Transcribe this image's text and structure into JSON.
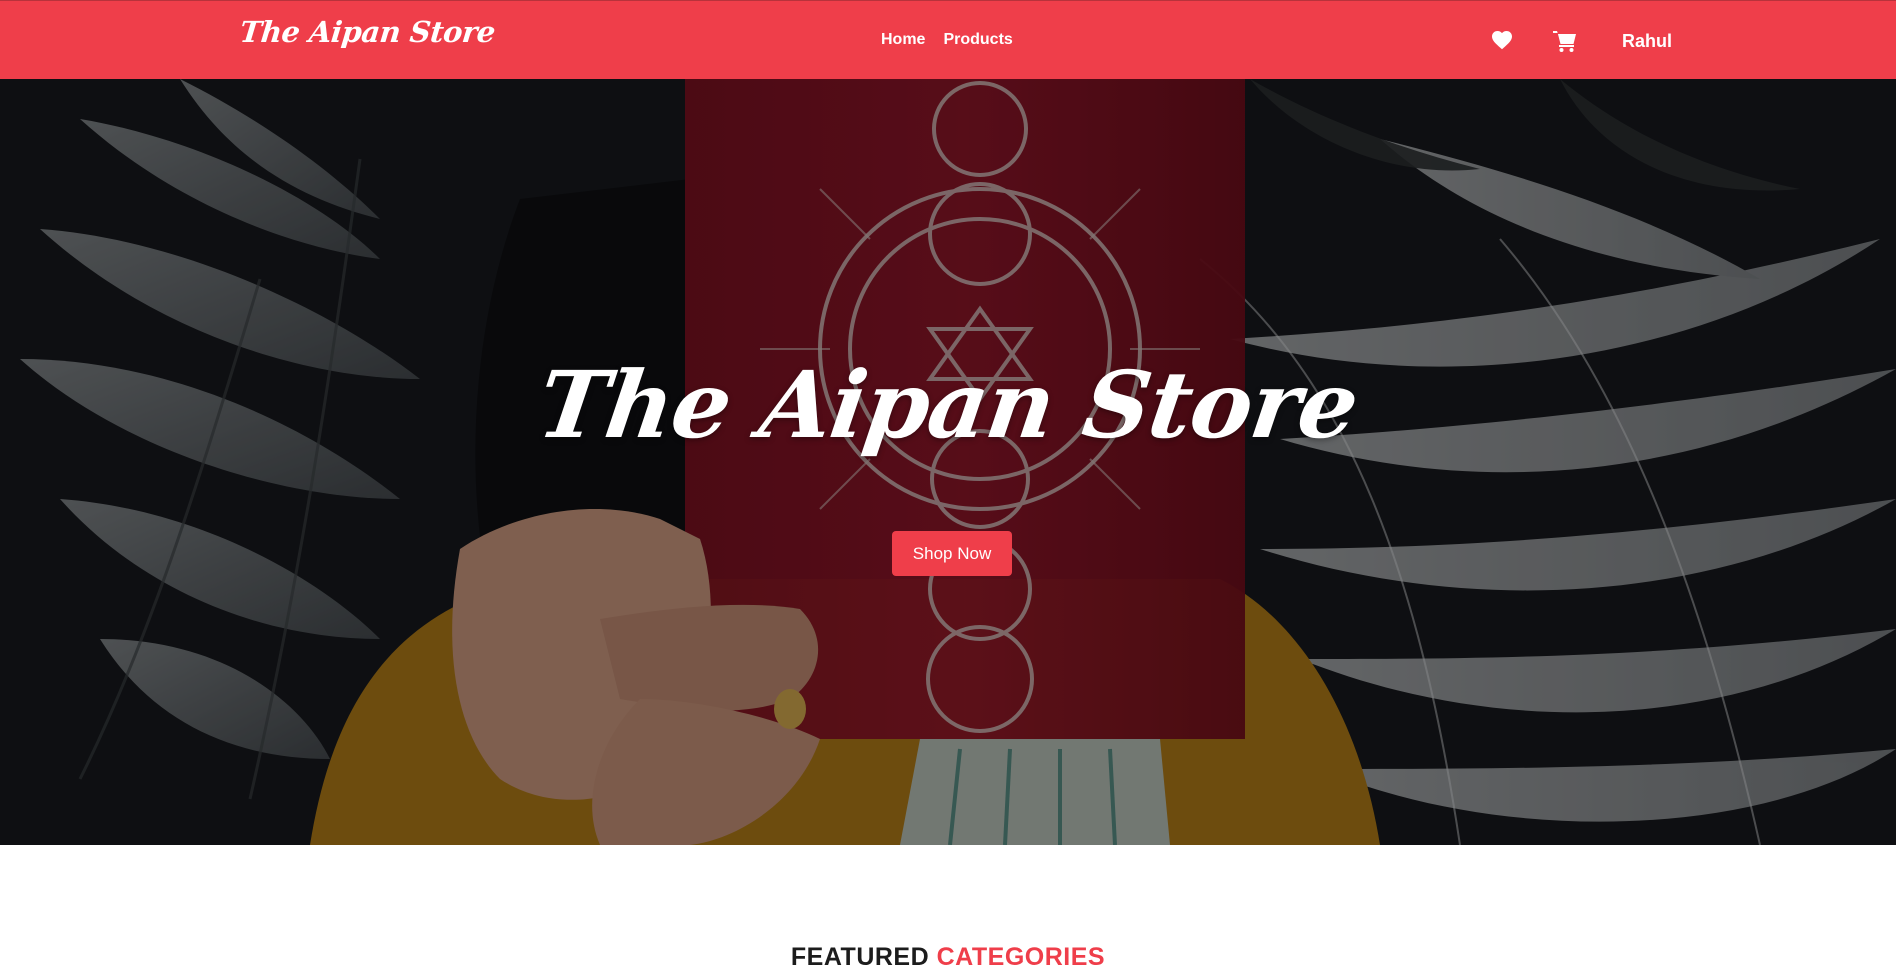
{
  "navbar": {
    "brand": "The Aipan Store",
    "links": [
      {
        "label": "Home"
      },
      {
        "label": "Products"
      }
    ],
    "icons": [
      "heart-icon",
      "cart-icon"
    ],
    "user_name": "Rahul"
  },
  "hero": {
    "title": "The Aipan Store",
    "cta_label": "Shop Now"
  },
  "featured": {
    "heading_part1": "FEATURED",
    "heading_part2": "CATEGORIES"
  },
  "colors": {
    "accent": "#ef3e4a",
    "text_dark": "#1c1c1c",
    "white": "#ffffff"
  }
}
